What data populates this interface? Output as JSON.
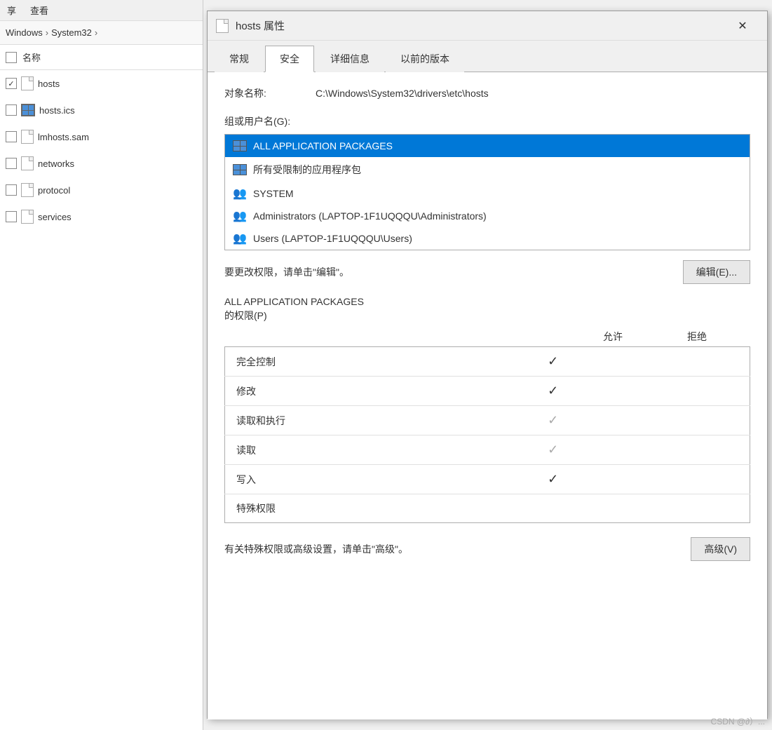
{
  "leftPanel": {
    "menuItems": [
      "享",
      "查看"
    ],
    "breadcrumb": {
      "parts": [
        "Windows",
        "System32"
      ]
    },
    "header": {
      "checkbox": "unchecked",
      "label": "名称"
    },
    "files": [
      {
        "id": "hosts",
        "name": "hosts",
        "type": "doc",
        "checked": true,
        "selected": false
      },
      {
        "id": "hosts-ics",
        "name": "hosts.ics",
        "type": "grid",
        "checked": false,
        "selected": false
      },
      {
        "id": "lmhosts",
        "name": "lmhosts.sam",
        "type": "doc",
        "checked": false,
        "selected": false
      },
      {
        "id": "networks",
        "name": "networks",
        "type": "doc",
        "checked": false,
        "selected": false
      },
      {
        "id": "protocol",
        "name": "protocol",
        "type": "doc",
        "checked": false,
        "selected": false
      },
      {
        "id": "services",
        "name": "services",
        "type": "doc",
        "checked": false,
        "selected": false
      }
    ]
  },
  "dialog": {
    "title": "hosts 属性",
    "closeLabel": "✕",
    "tabs": [
      {
        "id": "general",
        "label": "常规"
      },
      {
        "id": "security",
        "label": "安全",
        "active": true
      },
      {
        "id": "details",
        "label": "详细信息"
      },
      {
        "id": "previous",
        "label": "以前的版本"
      }
    ],
    "security": {
      "objectLabel": "对象名称:",
      "objectValue": "C:\\Windows\\System32\\drivers\\etc\\hosts",
      "groupLabel": "组或用户名(G):",
      "users": [
        {
          "id": "app-packages",
          "name": "ALL APPLICATION PACKAGES",
          "iconType": "pkg",
          "selected": true
        },
        {
          "id": "restricted",
          "name": "所有受限制的应用程序包",
          "iconType": "pkg",
          "selected": false
        },
        {
          "id": "system",
          "name": "SYSTEM",
          "iconType": "people",
          "selected": false
        },
        {
          "id": "administrators",
          "name": "Administrators (LAPTOP-1F1UQQQU\\Administrators)",
          "iconType": "people",
          "selected": false
        },
        {
          "id": "users",
          "name": "Users (LAPTOP-1F1UQQQU\\Users)",
          "iconType": "people",
          "selected": false
        }
      ],
      "editHint": "要更改权限，请单击\"编辑\"。",
      "editButton": "编辑(E)...",
      "permSectionLabel1": "ALL APPLICATION PACKAGES",
      "permSectionLabel2": "的权限(P)",
      "colAllow": "允许",
      "colDeny": "拒绝",
      "permissions": [
        {
          "name": "完全控制",
          "allow": true,
          "allowDim": false,
          "deny": false
        },
        {
          "name": "修改",
          "allow": true,
          "allowDim": false,
          "deny": false
        },
        {
          "name": "读取和执行",
          "allow": true,
          "allowDim": true,
          "deny": false
        },
        {
          "name": "读取",
          "allow": true,
          "allowDim": true,
          "deny": false
        },
        {
          "name": "写入",
          "allow": true,
          "allowDim": false,
          "deny": false
        },
        {
          "name": "特殊权限",
          "allow": false,
          "allowDim": false,
          "deny": false
        }
      ],
      "advancedHint": "有关特殊权限或高级设置，请单击\"高级\"。",
      "advancedButton": "高级(V)"
    }
  },
  "watermark": "CSDN @∂）..."
}
